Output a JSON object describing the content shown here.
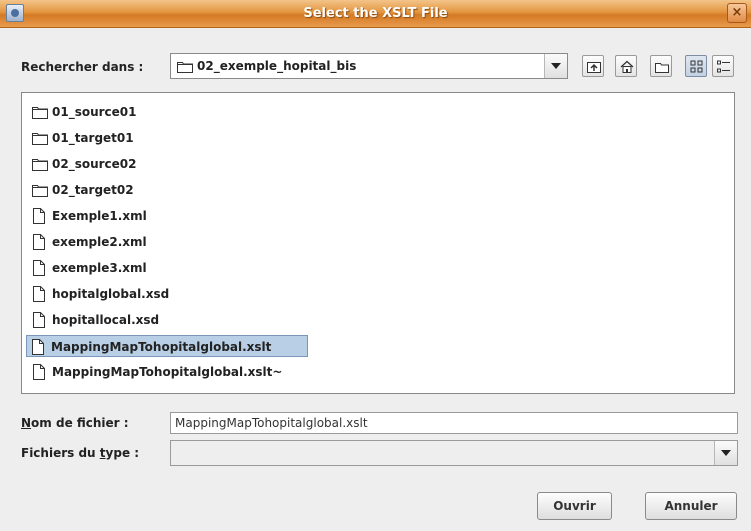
{
  "window": {
    "title": "Select the XSLT File",
    "close_glyph": "×"
  },
  "lookin": {
    "label": "Rechercher dans :",
    "value": "02_exemple_hopital_bis"
  },
  "toolbar": {
    "buttons": [
      "up-one-level-icon",
      "home-icon",
      "new-folder-icon",
      "list-view-icon",
      "details-view-icon"
    ]
  },
  "files": {
    "items": [
      {
        "name": "01_source01",
        "type": "folder"
      },
      {
        "name": "01_target01",
        "type": "folder"
      },
      {
        "name": "02_source02",
        "type": "folder"
      },
      {
        "name": "02_target02",
        "type": "folder"
      },
      {
        "name": "Exemple1.xml",
        "type": "file"
      },
      {
        "name": "exemple2.xml",
        "type": "file"
      },
      {
        "name": "exemple3.xml",
        "type": "file"
      },
      {
        "name": "hopitalglobal.xsd",
        "type": "file"
      },
      {
        "name": "hopitallocal.xsd",
        "type": "file"
      },
      {
        "name": "MappingMapTohopitalglobal.xslt",
        "type": "file",
        "selected": true
      },
      {
        "name": "MappingMapTohopitalglobal.xslt~",
        "type": "file"
      }
    ]
  },
  "filename": {
    "label_mnemonic": "N",
    "label_rest": "om de fichier :",
    "value": "MappingMapTohopitalglobal.xslt"
  },
  "filetype": {
    "label_pre": "Fichiers du ",
    "label_mnemonic": "t",
    "label_post": "ype :",
    "value": ""
  },
  "actions": {
    "open_label": "Ouvrir",
    "cancel_label": "Annuler"
  },
  "colors": {
    "titlebar": "#e3963f",
    "selection": "#b8cfe5"
  }
}
